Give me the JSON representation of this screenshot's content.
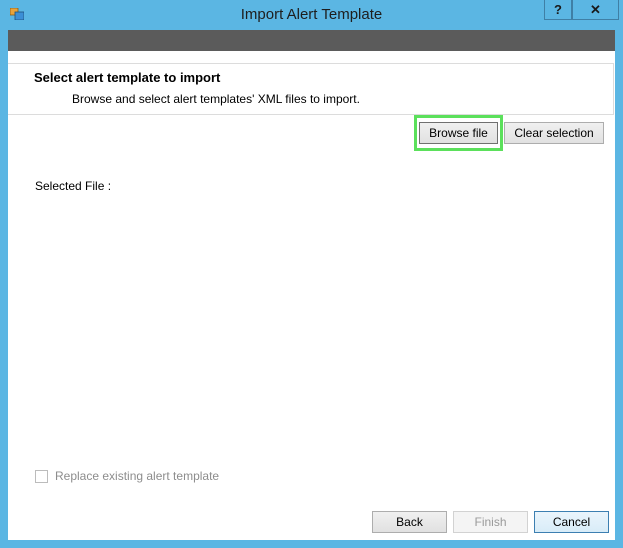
{
  "window": {
    "title": "Import Alert Template",
    "help_label": "?",
    "close_label": "✕"
  },
  "header": {
    "title": "Select alert template to import",
    "subtitle": "Browse and select alert templates' XML files to import."
  },
  "actions": {
    "browse_label": "Browse file",
    "clear_label": "Clear selection"
  },
  "selected_file": {
    "label": "Selected File :",
    "value": ""
  },
  "options": {
    "replace_label": "Replace existing alert template",
    "replace_checked": false,
    "replace_enabled": false
  },
  "footer": {
    "back_label": "Back",
    "finish_label": "Finish",
    "cancel_label": "Cancel"
  },
  "colors": {
    "window_frame": "#5bb6e3",
    "header_bar": "#5b5b5b",
    "highlight": "#5be05b"
  }
}
